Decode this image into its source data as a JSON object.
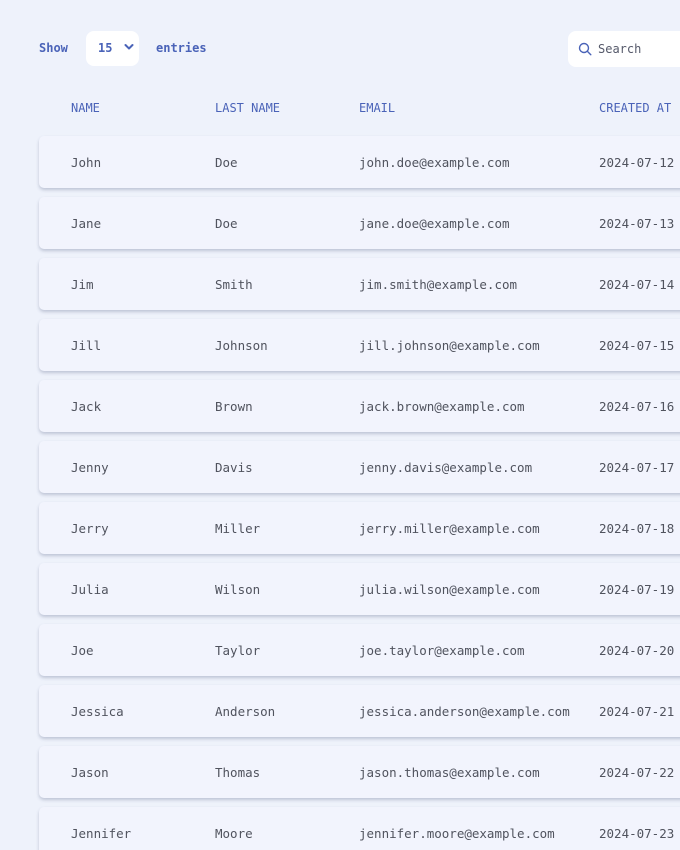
{
  "controls": {
    "show_label": "Show",
    "entries_value": "15",
    "entries_label": "entries",
    "search_placeholder": "Search"
  },
  "table": {
    "columns": [
      "Name",
      "Last Name",
      "Email",
      "Created At"
    ],
    "rows": [
      {
        "name": "John",
        "last_name": "Doe",
        "email": "john.doe@example.com",
        "created_at": "2024-07-12"
      },
      {
        "name": "Jane",
        "last_name": "Doe",
        "email": "jane.doe@example.com",
        "created_at": "2024-07-13"
      },
      {
        "name": "Jim",
        "last_name": "Smith",
        "email": "jim.smith@example.com",
        "created_at": "2024-07-14"
      },
      {
        "name": "Jill",
        "last_name": "Johnson",
        "email": "jill.johnson@example.com",
        "created_at": "2024-07-15"
      },
      {
        "name": "Jack",
        "last_name": "Brown",
        "email": "jack.brown@example.com",
        "created_at": "2024-07-16"
      },
      {
        "name": "Jenny",
        "last_name": "Davis",
        "email": "jenny.davis@example.com",
        "created_at": "2024-07-17"
      },
      {
        "name": "Jerry",
        "last_name": "Miller",
        "email": "jerry.miller@example.com",
        "created_at": "2024-07-18"
      },
      {
        "name": "Julia",
        "last_name": "Wilson",
        "email": "julia.wilson@example.com",
        "created_at": "2024-07-19"
      },
      {
        "name": "Joe",
        "last_name": "Taylor",
        "email": "joe.taylor@example.com",
        "created_at": "2024-07-20"
      },
      {
        "name": "Jessica",
        "last_name": "Anderson",
        "email": "jessica.anderson@example.com",
        "created_at": "2024-07-21"
      },
      {
        "name": "Jason",
        "last_name": "Thomas",
        "email": "jason.thomas@example.com",
        "created_at": "2024-07-22"
      },
      {
        "name": "Jennifer",
        "last_name": "Moore",
        "email": "jennifer.moore@example.com",
        "created_at": "2024-07-23"
      }
    ]
  },
  "colors": {
    "accent": "#4a63b8",
    "background": "#eef2fb",
    "row_background": "#f2f4fd",
    "cell_text": "#50535e"
  },
  "icons": {
    "search": "search-icon",
    "dropdown": "chevron-down-icon"
  }
}
